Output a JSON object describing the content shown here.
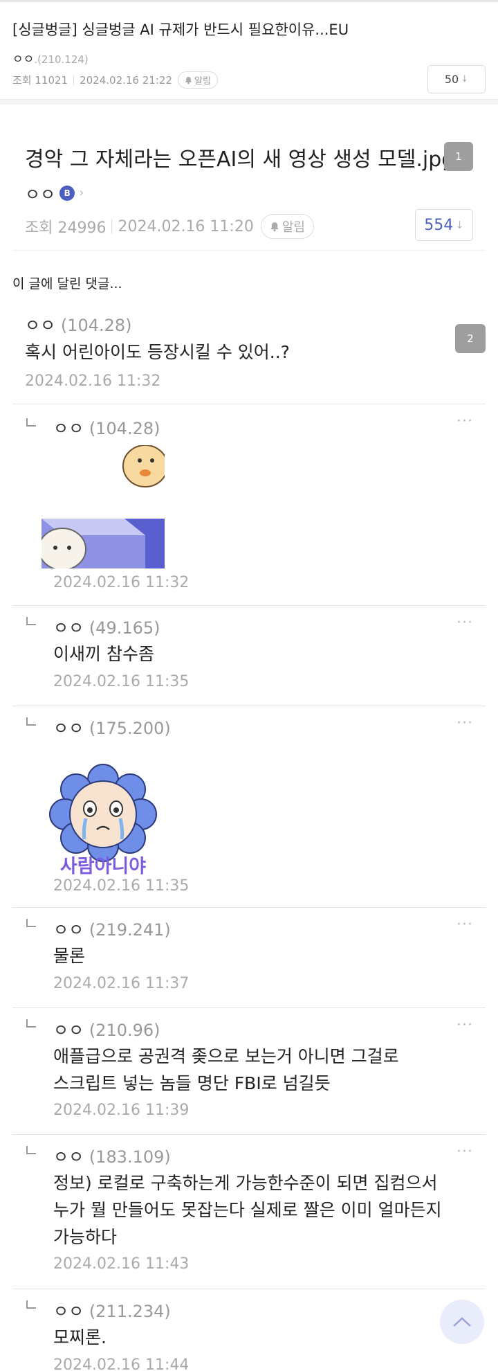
{
  "post1": {
    "title": "[싱글벙글] 싱글벙글 AI 규제가 반드시 필요한이유...EU",
    "author": "ㅇㅇ",
    "author_ip": ".(210.124)",
    "views": "조회 11021",
    "date": "2024.02.16 21:22",
    "alarm_label": "알림",
    "comment_count": "50"
  },
  "post2": {
    "title": "경악 그 자체라는 오픈AI의 새 영상 생성 모델.jpg",
    "badge_count": "1",
    "author": "ㅇㅇ",
    "author_badge": "B",
    "views": "조회 24996",
    "date": "2024.02.16 11:20",
    "alarm_label": "알림",
    "comment_count": "554"
  },
  "comments_header": "이 글에 달린 댓글...",
  "comments": [
    {
      "author": "ㅇㅇ",
      "ip": "(104.28)",
      "body": "혹시 어린아이도 등장시킬 수 있어..?",
      "date": "2024.02.16 11:32",
      "reply_count": "2"
    },
    {
      "author": "ㅇㅇ",
      "ip": "(104.28)",
      "date": "2024.02.16 11:32"
    },
    {
      "author": "ㅇㅇ",
      "ip": "(49.165)",
      "body": "이새끼 참수좀",
      "date": "2024.02.16 11:35"
    },
    {
      "author": "ㅇㅇ",
      "ip": "(175.200)",
      "sticker_text": "사람아니야",
      "date": "2024.02.16 11:35"
    },
    {
      "author": "ㅇㅇ",
      "ip": "(219.241)",
      "body": "물론",
      "date": "2024.02.16 11:37"
    },
    {
      "author": "ㅇㅇ",
      "ip": "(210.96)",
      "body_lines": [
        "애플급으로 공권격 좆으로 보는거 아니면 그걸로",
        "스크립트 넣는 놈들 명단 FBI로 넘길듯"
      ],
      "date": "2024.02.16 11:39"
    },
    {
      "author": "ㅇㅇ",
      "ip": "(183.109)",
      "body_lines": [
        "정보) 로컬로 구축하는게 가능한수준이 되면 집컴으서",
        "누가 뭘 만들어도 못잡는다 실제로 짤은 이미 얼마든지",
        "가능하다"
      ],
      "date": "2024.02.16 11:43"
    },
    {
      "author": "ㅇㅇ",
      "ip": "(211.234)",
      "body": "모찌론.",
      "date": "2024.02.16 11:44"
    }
  ],
  "more_icon": "ellipsis-icon",
  "scroll_top_icon": "chevron-up-icon"
}
